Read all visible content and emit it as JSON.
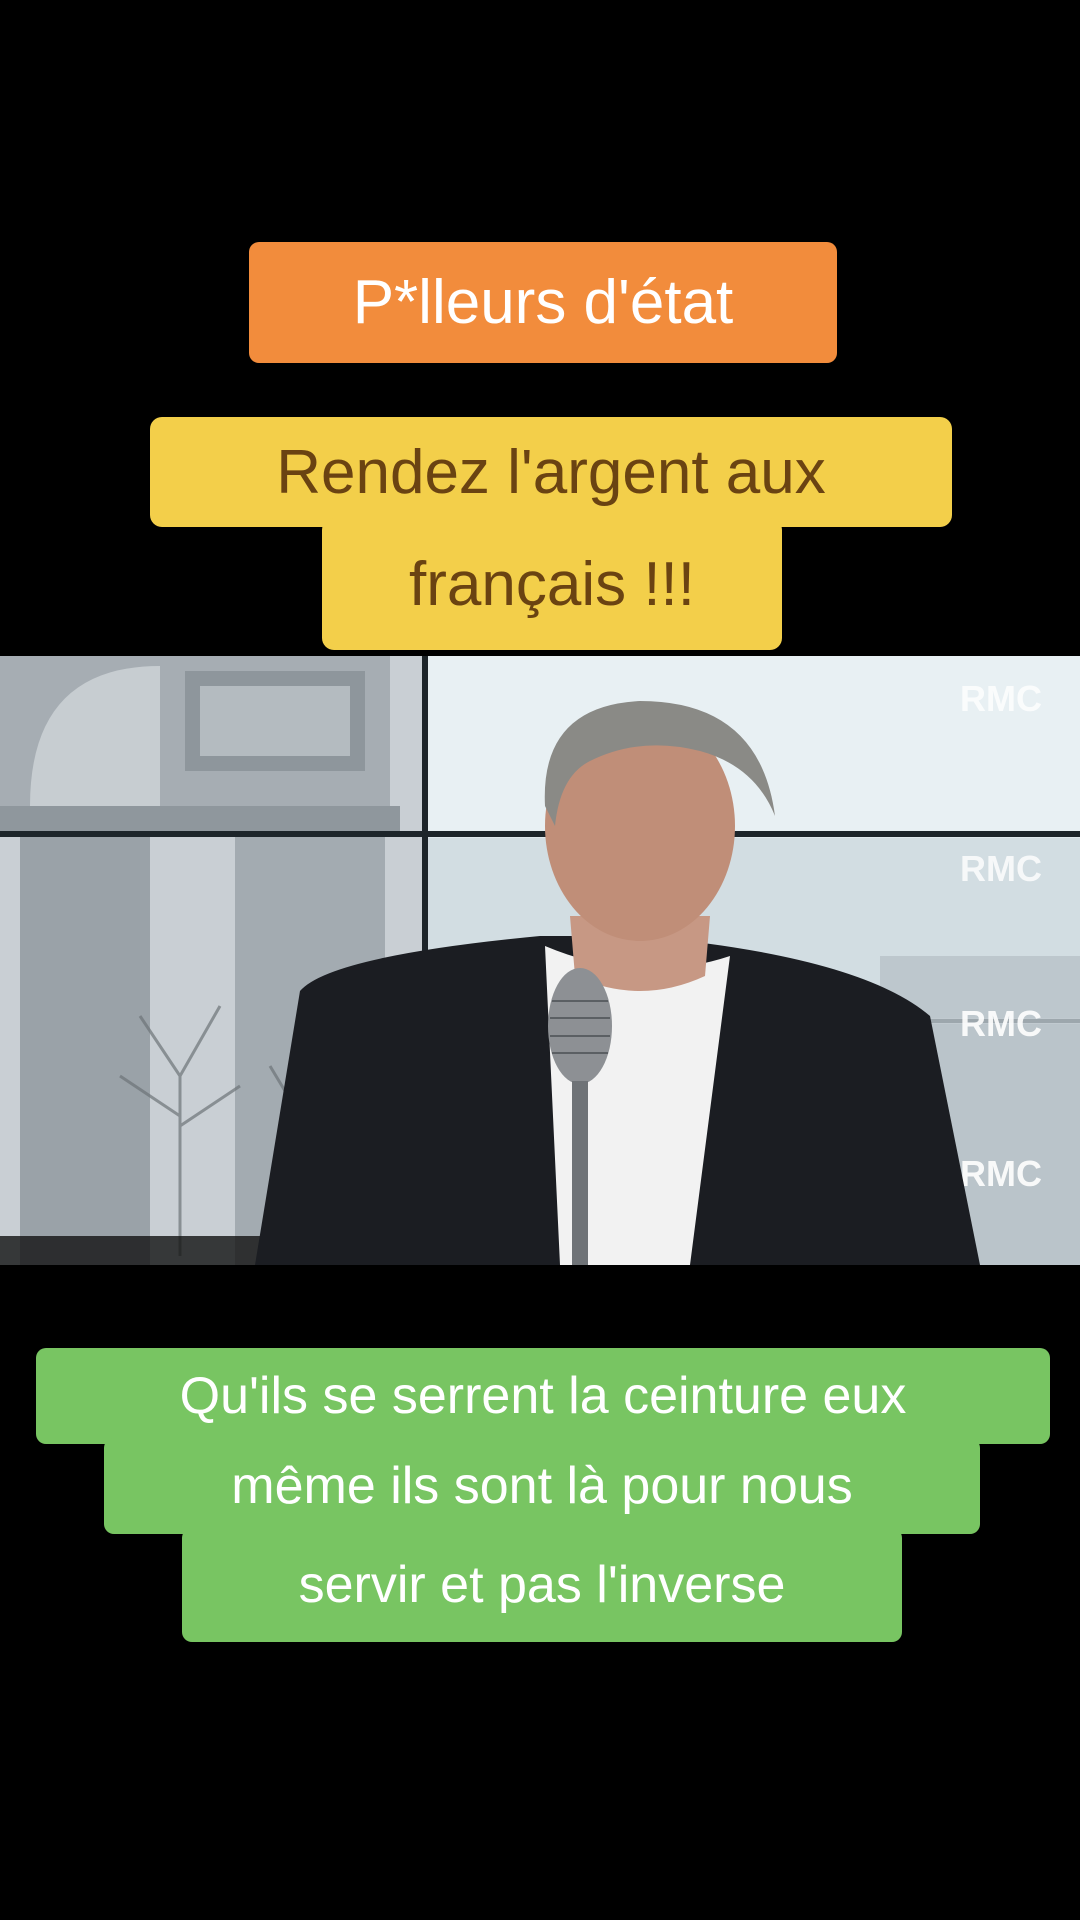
{
  "captions": {
    "top_title": "P*lleurs d'état",
    "headline_line1": "Rendez l'argent aux",
    "headline_line2": "français !!!",
    "subtitle_line1": "Qu'ils se serrent la ceinture eux",
    "subtitle_line2": "même ils sont là pour nous",
    "subtitle_line3": "servir et pas l'inverse"
  },
  "video": {
    "channel_logo_1": "RMC",
    "channel_logo_2": "RMC",
    "channel_logo_3": "RMC",
    "channel_logo_4": "RMC"
  },
  "colors": {
    "background": "#000000",
    "title_box": "#f28c3c",
    "headline_box": "#f3cf4a",
    "headline_text": "#6a4312",
    "subtitle_box": "#78c562",
    "subtitle_text": "#ffffff"
  }
}
